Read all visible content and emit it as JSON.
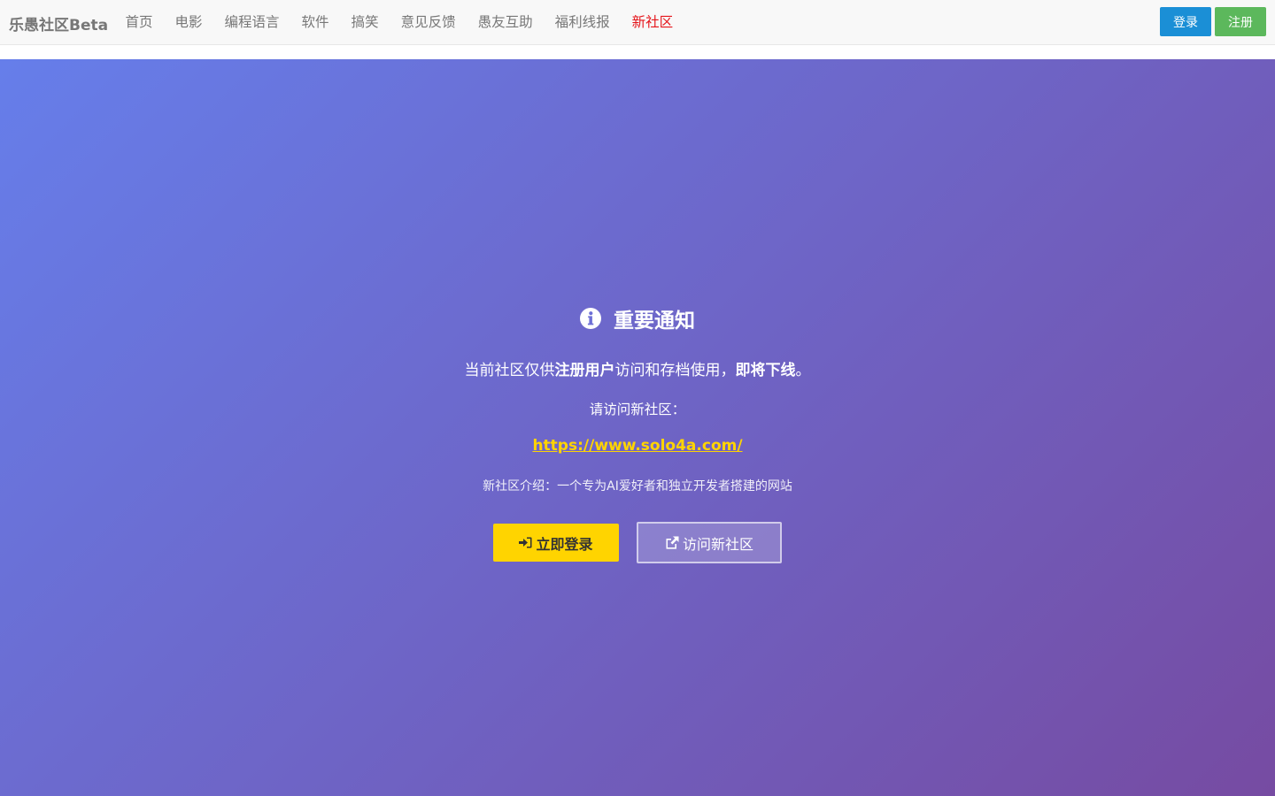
{
  "navbar": {
    "brand": "乐愚社区Beta",
    "items": [
      {
        "label": "首页"
      },
      {
        "label": "电影"
      },
      {
        "label": "编程语言"
      },
      {
        "label": "软件"
      },
      {
        "label": "搞笑"
      },
      {
        "label": "意见反馈"
      },
      {
        "label": "愚友互助"
      },
      {
        "label": "福利线报"
      },
      {
        "label": "新社区"
      }
    ],
    "login_label": "登录",
    "register_label": "注册"
  },
  "notice": {
    "icon": "info-circle-icon",
    "title": "重要通知",
    "line1_prefix": "当前社区仅供",
    "line1_bold1": "注册用户",
    "line1_middle": "访问和存档使用，",
    "line1_bold2": "即将下线",
    "line1_suffix": "。",
    "line2": "请访问新社区：",
    "link": "https://www.solo4a.com/",
    "intro": "新社区介绍：一个专为AI爱好者和独立开发者搭建的网站",
    "login_now_label": "立即登录",
    "login_now_icon": "sign-in-icon",
    "visit_new_label": "访问新社区",
    "visit_new_icon": "external-link-icon"
  },
  "colors": {
    "navbar_bg": "#f8f8f8",
    "nav_text": "#777777",
    "nav_highlight": "#e5141a",
    "login_btn": "#1b8fd6",
    "register_btn": "#5cb85c",
    "hero_gradient_start": "#667eea",
    "hero_gradient_end": "#764ba2",
    "link_color": "#ffd400",
    "login_now_bg": "#ffd400"
  }
}
